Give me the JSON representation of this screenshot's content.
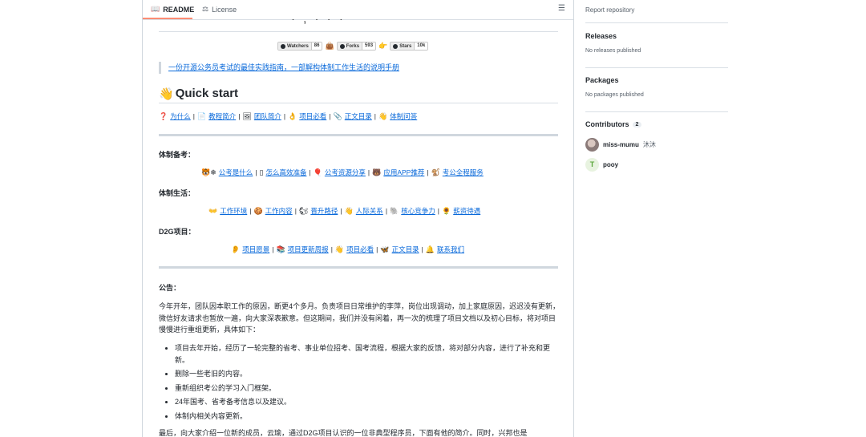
{
  "tabs": {
    "readme": "README",
    "license": "License"
  },
  "cut_heading": "· , · · ·",
  "badges": [
    {
      "label": "Watchers",
      "value": "86"
    },
    {
      "label": "Forks",
      "value": "593"
    },
    {
      "label": "Stars",
      "value": "10k"
    }
  ],
  "quote": "一份开源公务员考试的最佳实践指南，一部解构体制工作生活的说明手册",
  "quick_start": {
    "icon": "👋",
    "title": "Quick start"
  },
  "nav_links": [
    {
      "icon": "❓",
      "label": "为什么"
    },
    {
      "icon": "📄",
      "label": "教程简介"
    },
    {
      "icon": "🖼",
      "label": "团队简介"
    },
    {
      "icon": "👌",
      "label": "项目必看"
    },
    {
      "icon": "📎",
      "label": "正文目录"
    },
    {
      "icon": "👋",
      "label": "体制问答"
    }
  ],
  "section1": {
    "title": "体制备考：",
    "links": [
      {
        "icon": "🐯❄",
        "label": "公考是什么"
      },
      {
        "icon": "▯",
        "label": "怎么高效准备"
      },
      {
        "icon": "🎈",
        "label": "公考资源分享"
      },
      {
        "icon": "🐻",
        "label": "应用APP推荐"
      },
      {
        "icon": "🐒",
        "label": "考公全程服务"
      }
    ]
  },
  "section2": {
    "title": "体制生活：",
    "links": [
      {
        "icon": "👐",
        "label": "工作环境"
      },
      {
        "icon": "🍪",
        "label": "工作内容"
      },
      {
        "icon": "🐿",
        "label": "晋升路径"
      },
      {
        "icon": "👋",
        "label": "人际关系"
      },
      {
        "icon": "🐘",
        "label": "核心竞争力"
      },
      {
        "icon": "🌻",
        "label": "薪资待遇"
      }
    ]
  },
  "section3": {
    "title": "D2G项目：",
    "links": [
      {
        "icon": "👂",
        "label": "项目愿景"
      },
      {
        "icon": "📚",
        "label": "项目更新周报"
      },
      {
        "icon": "👋",
        "label": "项目必看"
      },
      {
        "icon": "🦋",
        "label": "正文目录"
      },
      {
        "icon": "🔔",
        "label": "联系我们"
      }
    ]
  },
  "notice": {
    "title": "公告：",
    "intro": "今年开年，团队因本职工作的原因，断更4个多月。负责项目日常维护的李萍，岗位出现调动，加上家庭原因，迟迟没有更新，微信好友请求也暂放一遍，向大家深表歉意。但这期间，我们并没有闲着，再一次的梳理了项目文档以及初心目标，将对项目慢慢进行重组更新，具体如下：",
    "bullets": [
      "项目去年开始，经历了一轮完整的省考、事业单位招考、国考流程，根据大家的反馈，将对部分内容，进行了补充和更新。",
      "删除一些老旧的内容。",
      "重新组织考公的学习入门框架。",
      "24年国考、省考备考信息以及建议。",
      "体制内相关内容更新。"
    ],
    "outro": "最后，向大家介绍一位新的成员，云瑜，通过D2G项目认识的一位非典型程序员，下面有他的简介。同时，兴邦也是"
  },
  "sidebar": {
    "report": "Report repository",
    "releases_title": "Releases",
    "releases_note": "No releases published",
    "packages_title": "Packages",
    "packages_note": "No packages published",
    "contributors_title": "Contributors",
    "contributors_count": "2",
    "contributors": [
      {
        "name": "miss-mumu",
        "sub": "沐沐"
      },
      {
        "name": "pooy",
        "sub": ""
      }
    ]
  }
}
